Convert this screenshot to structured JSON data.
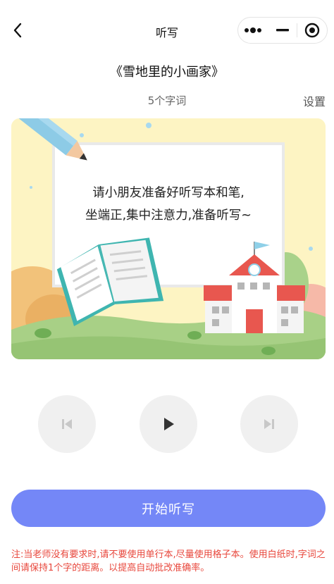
{
  "nav": {
    "title": "听写"
  },
  "header": {
    "book_title": "《雪地里的小画家》",
    "word_count": "5个字词",
    "settings_label": "设置"
  },
  "illustration": {
    "line1": "请小朋友准备好听写本和笔,",
    "line2": "坐端正,集中注意力,准备听写~"
  },
  "controls": {
    "prev_icon": "skip-previous-icon",
    "play_icon": "play-icon",
    "next_icon": "skip-next-icon"
  },
  "start_button": {
    "label": "开始听写"
  },
  "notice": "注:当老师没有要求时,请不要使用单行本,尽量使用格子本。使用白纸时,字词之间请保持1个字的距离。以提高自动批改准确率。",
  "colors": {
    "accent": "#7487f7",
    "notice": "#e8473c",
    "card_bg": "#fdf4c3"
  }
}
